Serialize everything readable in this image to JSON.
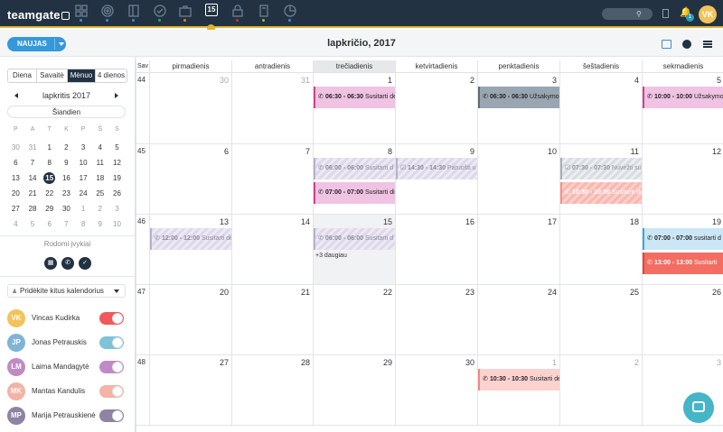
{
  "topbar": {
    "logo": "teamgate",
    "nav_icons": [
      "dashboard-icon",
      "target-icon",
      "contacts-icon",
      "deals-icon",
      "briefcase-icon",
      "calendar-icon",
      "lock-icon",
      "documents-icon",
      "reports-icon"
    ],
    "calendar_tab_day": "15",
    "notification_count": "1",
    "user_initials": "VK"
  },
  "subbar": {
    "new_button": "NAUJAS",
    "title": "lapkričio, 2017"
  },
  "sidebar": {
    "views": [
      "Diena",
      "Savaitė",
      "Mėnuo",
      "4 dienos"
    ],
    "active_view": "Mėnuo",
    "mini_month": "lapkritis 2017",
    "today_button": "Šiandien",
    "weekdays": [
      "P",
      "A",
      "T",
      "K",
      "P",
      "Š",
      "S"
    ],
    "mini_weeks": [
      [
        "30",
        "31",
        "1",
        "2",
        "3",
        "4",
        "5"
      ],
      [
        "6",
        "7",
        "8",
        "9",
        "10",
        "11",
        "12"
      ],
      [
        "13",
        "14",
        "15",
        "16",
        "17",
        "18",
        "19"
      ],
      [
        "20",
        "21",
        "22",
        "23",
        "24",
        "25",
        "26"
      ],
      [
        "27",
        "28",
        "29",
        "30",
        "1",
        "2",
        "3"
      ],
      [
        "4",
        "5",
        "6",
        "7",
        "8",
        "9",
        "10"
      ]
    ],
    "shown_events_label": "Rodomi įvykiai",
    "add_calendars_label": "Pridėkite kitus kalendorius",
    "calendars": [
      {
        "initials": "VK",
        "name": "Vincas Kudirka",
        "avatar_color": "#f3c35a",
        "toggle_color": "#f05a5a"
      },
      {
        "initials": "JP",
        "name": "Jonas Petrauskis",
        "avatar_color": "#7fb4d6",
        "toggle_color": "#7fc3d8"
      },
      {
        "initials": "LM",
        "name": "Laima Mandagytė",
        "avatar_color": "#c08bc4",
        "toggle_color": "#c08bc4"
      },
      {
        "initials": "MK",
        "name": "Mantas Kandulis",
        "avatar_color": "#f3b3a6",
        "toggle_color": "#f3b3a6"
      },
      {
        "initials": "MP",
        "name": "Marija Petrauskienė",
        "avatar_color": "#8e83a3",
        "toggle_color": "#8e83a3"
      }
    ]
  },
  "calendar": {
    "week_header": "Sav",
    "days": [
      "pirmadienis",
      "antradienis",
      "trečiadienis",
      "ketvirtadienis",
      "penktadienis",
      "šeštadienis",
      "sekmadienis"
    ],
    "today_col": 2,
    "weeks": [
      {
        "num": "44",
        "dates": [
          "30",
          "31",
          "1",
          "2",
          "3",
          "4",
          "5"
        ],
        "other": [
          0,
          1
        ]
      },
      {
        "num": "45",
        "dates": [
          "6",
          "7",
          "8",
          "9",
          "10",
          "11",
          "12"
        ],
        "other": []
      },
      {
        "num": "46",
        "dates": [
          "13",
          "14",
          "15",
          "16",
          "17",
          "18",
          "19"
        ],
        "other": [],
        "today": 2
      },
      {
        "num": "47",
        "dates": [
          "20",
          "21",
          "22",
          "23",
          "24",
          "25",
          "26"
        ],
        "other": []
      },
      {
        "num": "48",
        "dates": [
          "27",
          "28",
          "29",
          "30",
          "1",
          "2",
          "3"
        ],
        "other": [
          4,
          5,
          6
        ]
      }
    ],
    "events": [
      {
        "week": 0,
        "day": 2,
        "slot": 0,
        "style": "pink",
        "icon": "✆",
        "time": "06:30 - 06:30",
        "text": "Susitarti dė"
      },
      {
        "week": 0,
        "day": 4,
        "slot": 0,
        "style": "gray",
        "icon": "✆",
        "time": "06:30 - 06:30",
        "text": "Užsakymo"
      },
      {
        "week": 0,
        "day": 6,
        "slot": 0,
        "style": "pink",
        "icon": "✆",
        "time": "10:00 - 10:00",
        "text": "Užsakymo"
      },
      {
        "week": 1,
        "day": 2,
        "slot": 0,
        "style": "hatchp",
        "icon": "✆",
        "time": "06:00 - 06:00",
        "text": "Susitarti d"
      },
      {
        "week": 1,
        "day": 3,
        "slot": 0,
        "style": "hatchp",
        "icon": "☑",
        "time": "14:30 - 14:30",
        "text": "Paruošti u"
      },
      {
        "week": 1,
        "day": 5,
        "slot": 0,
        "style": "hatchg",
        "icon": "☑",
        "time": "07:30 - 07:30",
        "text": "Nuvežti su"
      },
      {
        "week": 1,
        "day": 2,
        "slot": 1,
        "style": "pink",
        "icon": "✆",
        "time": "07:00 - 07:00",
        "text": "Susitarti di"
      },
      {
        "week": 1,
        "day": 5,
        "slot": 1,
        "style": "salmon",
        "icon": "✆",
        "time": "10:30 - 10:30",
        "text": "Susitarti di"
      },
      {
        "week": 2,
        "day": 0,
        "slot": 0,
        "style": "hatchp",
        "icon": "✆",
        "time": "12:00 - 12:00",
        "text": "Susitarti dė"
      },
      {
        "week": 2,
        "day": 2,
        "slot": 0,
        "style": "hatchp",
        "icon": "✆",
        "time": "06:00 - 06:00",
        "text": "Susitarti d"
      },
      {
        "week": 2,
        "day": 6,
        "slot": 0,
        "style": "cyan",
        "icon": "✆",
        "time": "07:00 - 07:00",
        "text": "susitarti d"
      },
      {
        "week": 2,
        "day": 6,
        "slot": 1,
        "style": "red",
        "icon": "✆",
        "time": "13:00 - 13:00",
        "text": "Susitarti"
      },
      {
        "week": 4,
        "day": 4,
        "slot": 0,
        "style": "lightred",
        "icon": "✆",
        "time": "10:30 - 10:30",
        "text": "Susitarti dė"
      }
    ],
    "more": [
      {
        "week": 2,
        "day": 2,
        "text": "+3 daugiau"
      }
    ]
  }
}
